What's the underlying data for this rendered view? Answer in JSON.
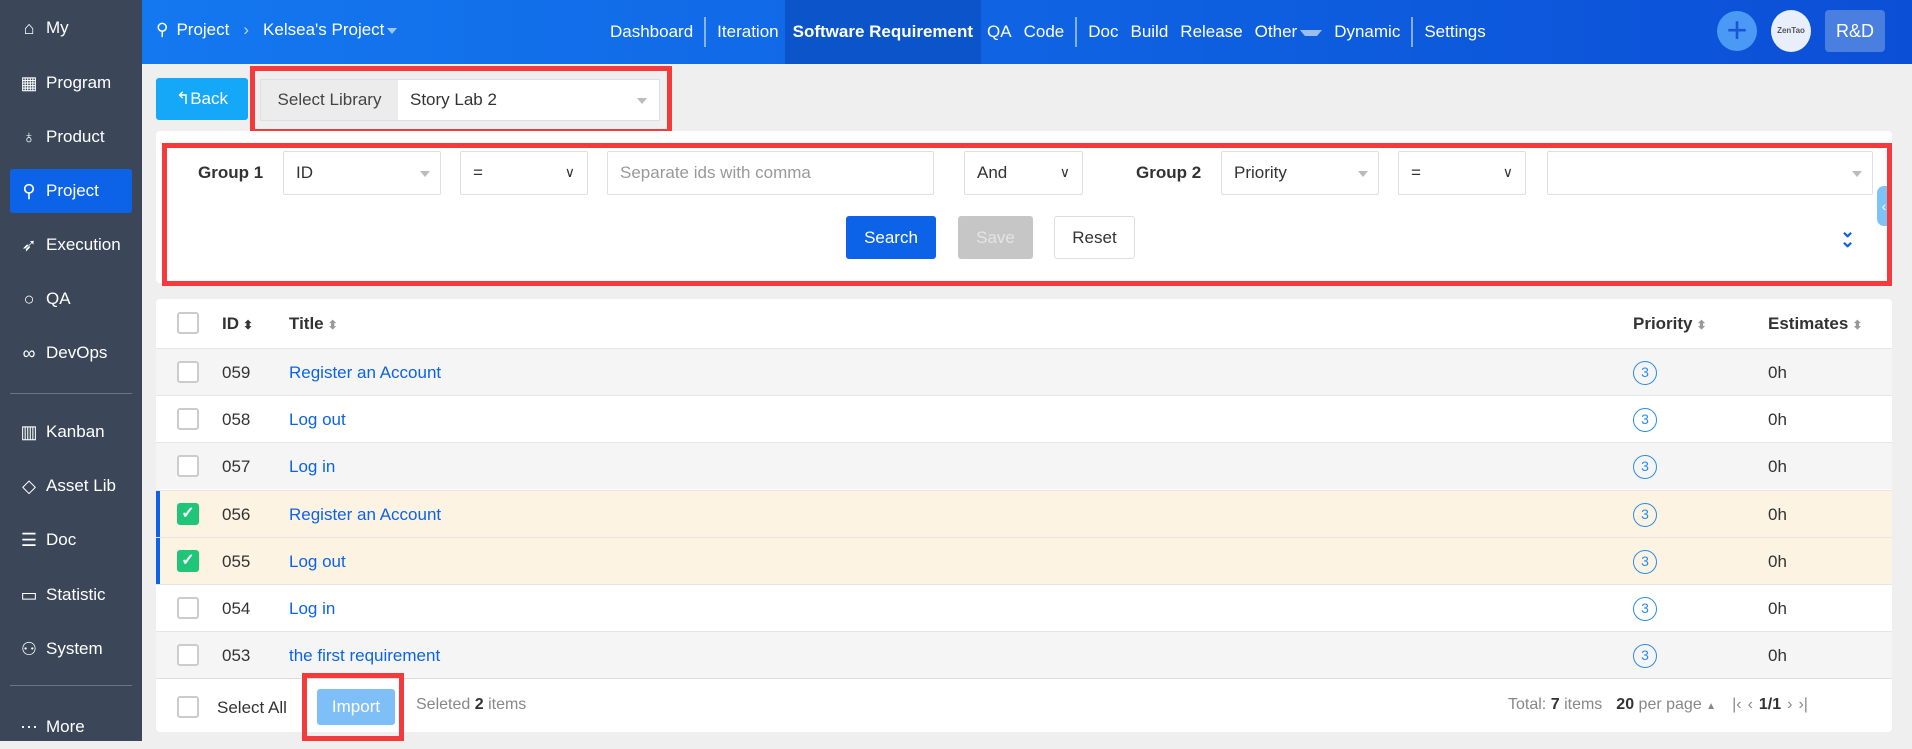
{
  "sidebar": {
    "items": [
      {
        "label": "My",
        "icon": "home-icon"
      },
      {
        "label": "Program",
        "icon": "grid-icon"
      },
      {
        "label": "Product",
        "icon": "bulb-icon"
      },
      {
        "label": "Project",
        "icon": "rocket-icon",
        "active": true
      },
      {
        "label": "Execution",
        "icon": "runner-icon"
      },
      {
        "label": "QA",
        "icon": "search-icon"
      },
      {
        "label": "DevOps",
        "icon": "infinity-icon"
      },
      {
        "label": "Kanban",
        "icon": "kanban-icon"
      },
      {
        "label": "Asset Lib",
        "icon": "diamond-icon"
      },
      {
        "label": "Doc",
        "icon": "doc-icon"
      },
      {
        "label": "Statistic",
        "icon": "monitor-icon"
      },
      {
        "label": "System",
        "icon": "users-icon"
      },
      {
        "label": "More",
        "icon": "more-icon"
      }
    ]
  },
  "header": {
    "breadcrumb_root": "Project",
    "breadcrumb_project": "Kelsea's Project",
    "nav": [
      "Dashboard",
      "Iteration",
      "Software Requirement",
      "QA",
      "Code",
      "Doc",
      "Build",
      "Release",
      "Other",
      "Dynamic",
      "Settings"
    ],
    "avatar": "ZenTao",
    "team": "R&D"
  },
  "toolbar": {
    "back": "Back",
    "library_label": "Select Library",
    "library_value": "Story Lab 2"
  },
  "filter": {
    "group1": "Group 1",
    "field1": "ID",
    "op1": "=",
    "value1_placeholder": "Separate ids with comma",
    "logic": "And",
    "group2": "Group 2",
    "field2": "Priority",
    "op2": "=",
    "value2": "",
    "search": "Search",
    "save": "Save",
    "reset": "Reset"
  },
  "table": {
    "columns": [
      "ID",
      "Title",
      "Priority",
      "Estimates"
    ],
    "rows": [
      {
        "id": "059",
        "title": "Register an Account",
        "priority": "3",
        "estimate": "0h",
        "checked": false
      },
      {
        "id": "058",
        "title": "Log out",
        "priority": "3",
        "estimate": "0h",
        "checked": false
      },
      {
        "id": "057",
        "title": "Log in",
        "priority": "3",
        "estimate": "0h",
        "checked": false
      },
      {
        "id": "056",
        "title": "Register an Account",
        "priority": "3",
        "estimate": "0h",
        "checked": true
      },
      {
        "id": "055",
        "title": "Log out",
        "priority": "3",
        "estimate": "0h",
        "checked": true
      },
      {
        "id": "054",
        "title": "Log in",
        "priority": "3",
        "estimate": "0h",
        "checked": false
      },
      {
        "id": "053",
        "title": "the first requirement",
        "priority": "3",
        "estimate": "0h",
        "checked": false
      }
    ]
  },
  "footer": {
    "select_all": "Select All",
    "import": "Import",
    "selected_prefix": "Seleted",
    "selected_count": "2",
    "selected_suffix": "items",
    "total_prefix": "Total:",
    "total_count": "7",
    "total_suffix": "items",
    "per_page_count": "20",
    "per_page_suffix": "per page",
    "page": "1/1"
  }
}
